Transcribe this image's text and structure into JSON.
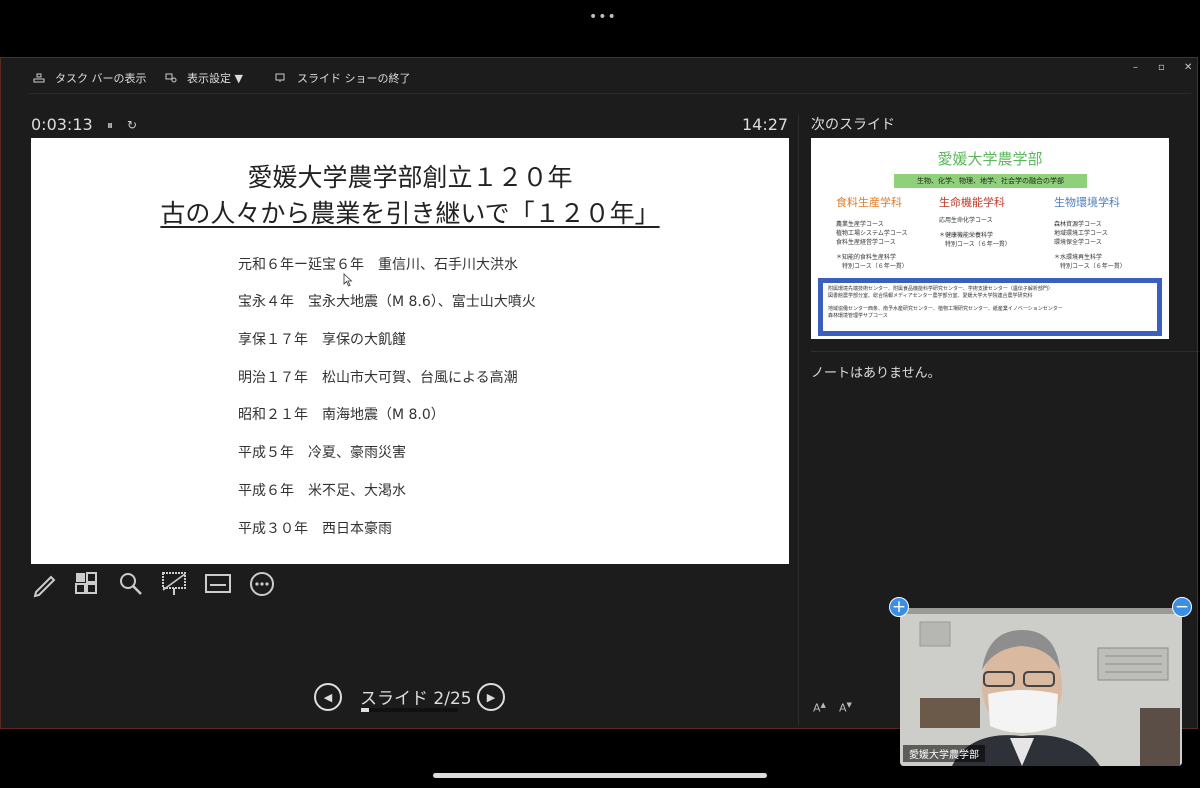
{
  "toolbar": {
    "taskbar_label": "タスク バーの表示",
    "display_settings_label": "表示設定 ▼",
    "end_show_label": "スライド ショーの終了",
    "win_minimize": "–",
    "win_restore": "▫"
  },
  "presenter": {
    "elapsed": "0:03:13",
    "pause_icon": "⏸",
    "reset_icon": "↻",
    "clock": "14:27",
    "slide_counter": "スライド 2/25",
    "progress": 0.08,
    "next_slide_label": "次のスライド",
    "notes": "ノートはありません。"
  },
  "current_slide": {
    "title_line1": "愛媛大学農学部創立１２０年",
    "title_line2": "古の人々から農業を引き継いで「１２０年」",
    "events": [
      "元和６年ー延宝６年　重信川、石手川大洪水",
      "宝永４年　宝永大地震（M 8.6）、富士山大噴火",
      "享保１７年　享保の大飢饉",
      "明治１７年　松山市大可賀、台風による高潮",
      "昭和２１年　南海地震（M 8.0）",
      "平成５年　冷夏、豪雨災害",
      "平成６年　米不足、大渇水",
      "平成３０年　西日本豪雨"
    ]
  },
  "next_slide": {
    "title": "愛媛大学農学部",
    "subtitle": "生物、化学、物理、地学、社会学の融合の学部",
    "dept1": {
      "name": "食料生産学科",
      "courses": [
        "農業生産学コース",
        "植物工場システム学コース",
        "食料生産経営学コース"
      ],
      "special": [
        "＊知能的食料生産科学",
        "　特別コース（６年一貫）"
      ]
    },
    "dept2": {
      "name": "生命機能学科",
      "courses": [
        "応用生命化学コース"
      ],
      "special": [
        "＊健康機能栄養科学",
        "　特別コース（６年一貫）"
      ]
    },
    "dept3": {
      "name": "生物環境学科",
      "courses": [
        "森林資源学コース",
        "地域環境工学コース",
        "環境保全学コース"
      ],
      "special": [
        "＊水環境再生科学",
        "　特別コース（６年一貫）"
      ]
    },
    "box_lines": [
      "附属環境先端技術センター、附属食品機能科学研究センター、学術支援センター（遺伝子解析部門）",
      "図書館農学部分室、総合情報メディアセンター農学部分室、愛媛大学大学院連合農学研究科",
      "地域協働センター西条、南予水産研究センター、植物工場研究センター、紙産業イノベーションセンター",
      "森林環境管理学サブコース"
    ]
  },
  "video": {
    "participant_name": "愛媛大学農学部"
  },
  "colors": {
    "accent_green": "#5cb85c",
    "dept_orange": "#e07b2a",
    "dept_red": "#c0392b",
    "dept_blue": "#4a7fc0",
    "box_blue": "#3a5fbf"
  }
}
